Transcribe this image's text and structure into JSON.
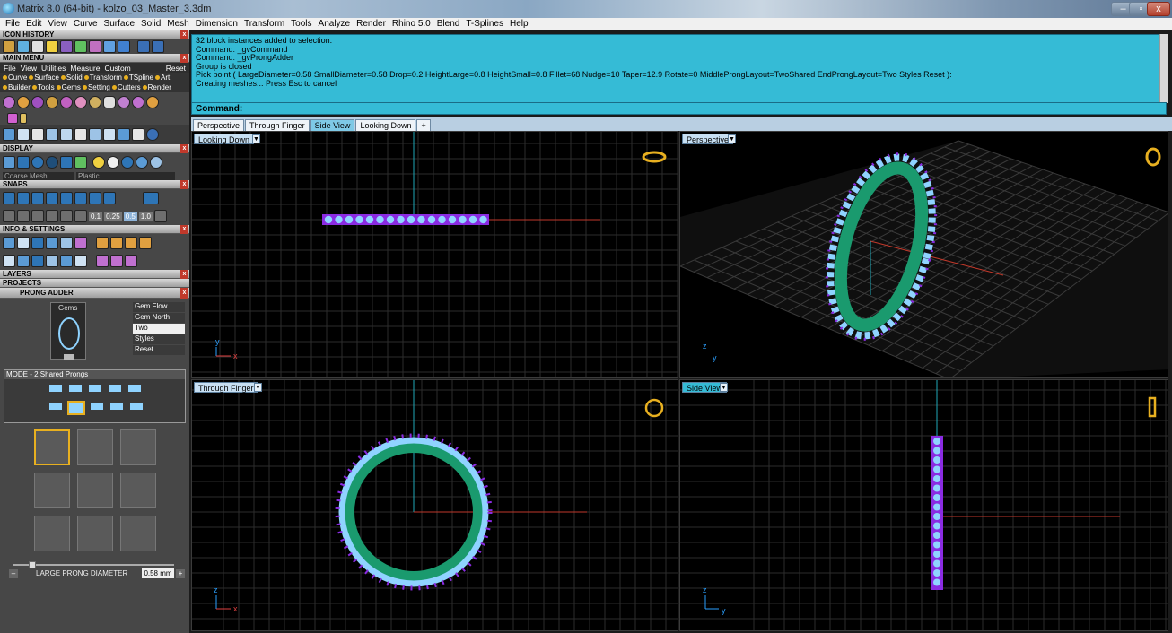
{
  "window": {
    "title": "Matrix 8.0 (64-bit) - kolzo_03_Master_3.3dm",
    "min": "–",
    "max": "▫",
    "close": "x"
  },
  "menu": [
    "File",
    "Edit",
    "View",
    "Curve",
    "Surface",
    "Solid",
    "Mesh",
    "Dimension",
    "Transform",
    "Tools",
    "Analyze",
    "Render",
    "Rhino 5.0",
    "Blend",
    "T-Splines",
    "Help"
  ],
  "panels": {
    "icon_history": "ICON HISTORY",
    "main_menu": "MAIN MENU",
    "main_menu_items": [
      "File",
      "View",
      "Utilities",
      "Measure",
      "Custom"
    ],
    "reset": "Reset",
    "categories1": [
      "Curve",
      "Surface",
      "Solid",
      "Transform",
      "TSpline",
      "Art"
    ],
    "categories2": [
      "Builder",
      "Tools",
      "Gems",
      "Setting",
      "Cutters",
      "Render"
    ],
    "display": "DISPLAY",
    "display_mode1": "Coarse Mesh",
    "display_mode2": "Plastic",
    "snaps": "SNAPS",
    "snap_values": [
      "0.1",
      "0.25",
      "0.5",
      "1.0"
    ],
    "info": "INFO & SETTINGS",
    "layers": "LAYERS",
    "projects": "PROJECTS",
    "prong_adder": "PRONG ADDER"
  },
  "prong": {
    "gems_label": "Gems",
    "gem_flow": "Gem Flow",
    "gem_north": "Gem North",
    "two": "Two",
    "styles": "Styles",
    "reset": "Reset",
    "mode": "MODE - 2 Shared Prongs",
    "slider_label": "LARGE PRONG DIAMETER",
    "slider_value": "0.58 mm",
    "minus": "–",
    "plus": "+",
    "slider_level": 0.12
  },
  "command": {
    "history": [
      "32 block instances added to selection.",
      "Command: _gvCommand",
      "Command: _gvProngAdder",
      "Group is closed",
      "Pick point ( LargeDiameter=0.58  SmallDiameter=0.58  Drop=0.2  HeightLarge=0.8  HeightSmall=0.8  Fillet=68  Nudge=10  Taper=12.9  Rotate=0  MiddleProngLayout=TwoShared  EndProngLayout=Two  Styles  Reset ):",
      "Creating meshes... Press Esc to cancel"
    ],
    "prompt": "Command:"
  },
  "tabs": [
    "Perspective",
    "Through Finger",
    "Side View",
    "Looking Down",
    "+"
  ],
  "viewports": {
    "top": "Looking Down",
    "persp": "Perspective",
    "front": "Through Finger",
    "side": "Side View",
    "axes": {
      "x": "x",
      "y": "y",
      "z": "z"
    }
  },
  "colors": {
    "cmd": "#35bbd6",
    "ring": "#1a9a6e",
    "gems": "#8fd3ff",
    "prongs": "#8a2be2",
    "grid": "#2c2c2c",
    "xaxis": "#c0392b",
    "yaxis": "#1fa9b8"
  }
}
